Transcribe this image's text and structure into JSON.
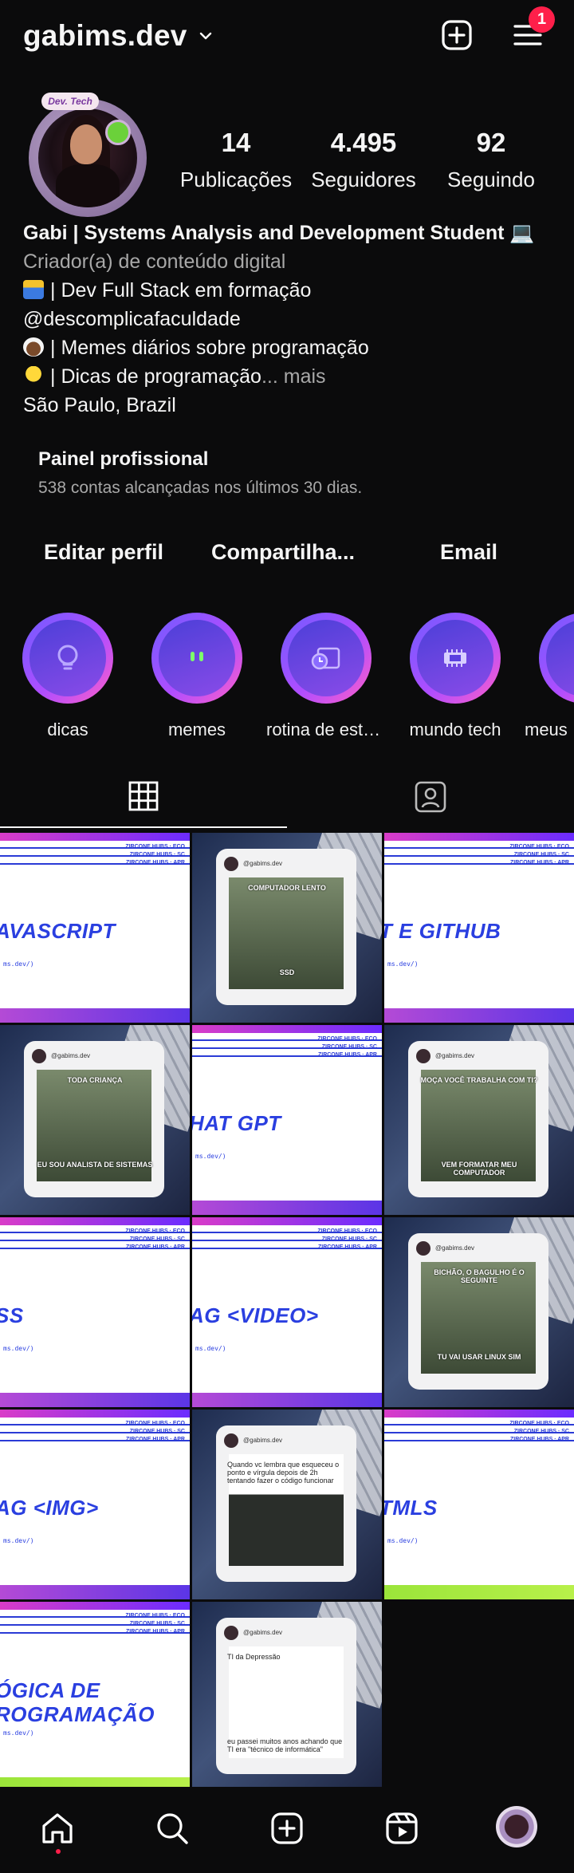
{
  "header": {
    "username": "gabims.dev",
    "notification_count": "1"
  },
  "profile": {
    "avatar_ribbon": "Dev. Tech",
    "stats": [
      {
        "value": "14",
        "label": "Publicações"
      },
      {
        "value": "4.495",
        "label": "Seguidores"
      },
      {
        "value": "92",
        "label": "Seguindo"
      }
    ],
    "bio": {
      "name": "Gabi | Systems Analysis and Development Student 💻",
      "category": "Criador(a) de conteúdo digital",
      "line1": "| Dev Full Stack em formação",
      "line2": "@descomplicafaculdade",
      "line3": "| Memes diários sobre programação",
      "line4": "| Dicas de programação",
      "more": "... mais",
      "location": "São Paulo, Brazil"
    }
  },
  "pro_panel": {
    "title": "Painel profissional",
    "subtitle": "538 contas alcançadas nos últimos 30 dias."
  },
  "actions": {
    "edit": "Editar perfil",
    "share": "Compartilha...",
    "email": "Email"
  },
  "highlights": [
    {
      "label": "dicas",
      "icon": "lightbulb-icon"
    },
    {
      "label": "memes",
      "icon": "smiley-icon"
    },
    {
      "label": "rotina de estu...",
      "icon": "calendar-clock-icon"
    },
    {
      "label": "mundo tech",
      "icon": "cpu-chip-icon"
    },
    {
      "label": "meus",
      "icon": "folder-icon"
    }
  ],
  "grid": {
    "slide_tagline": "ZIRCONE HUBS · ECO\nZIRCONE HUBS · SC\nZIRCONE HUBS · APR",
    "slide_url": "ms.dev/)",
    "meme_username": "@gabims.dev",
    "posts": [
      {
        "type": "slide",
        "text": "AVASCRIPT"
      },
      {
        "type": "meme",
        "caption_top": "COMPUTADOR LENTO",
        "caption_bottom": "SSD"
      },
      {
        "type": "slide",
        "text": "T E GITHUB"
      },
      {
        "type": "meme",
        "caption_top": "TODA CRIANÇA",
        "caption_bottom": "EU SOU ANALISTA DE SISTEMAS"
      },
      {
        "type": "slide",
        "text": "HAT GPT"
      },
      {
        "type": "meme",
        "caption_top": "MOÇA VOCÊ TRABALHA COM TI?",
        "caption_bottom": "VEM FORMATAR MEU COMPUTADOR"
      },
      {
        "type": "slide",
        "text": "SS"
      },
      {
        "type": "slide",
        "text": "AG <VIDEO>"
      },
      {
        "type": "meme",
        "caption_top": "BICHÃO, O BAGULHO É O SEGUINTE",
        "caption_bottom": "TU VAI USAR LINUX SIM"
      },
      {
        "type": "slide",
        "text": "AG <IMG>"
      },
      {
        "type": "meme",
        "caption_top": "Quando vc lembra que esqueceu o ponto e vírgula depois de 2h tentando fazer o código funcionar",
        "caption_bottom": ""
      },
      {
        "type": "slide-green",
        "text": "TMLS"
      },
      {
        "type": "slide-green",
        "text": "ÓGICA DE\nROGRAMAÇÃO"
      },
      {
        "type": "meme",
        "caption_top": "TI da Depressão",
        "caption_bottom": "eu passei muitos anos achando que TI era \"técnico de informática\""
      }
    ]
  },
  "colors": {
    "background": "#0b0b0c",
    "accent": "#ff1f4a",
    "highlight_ring": "#b04dff"
  }
}
